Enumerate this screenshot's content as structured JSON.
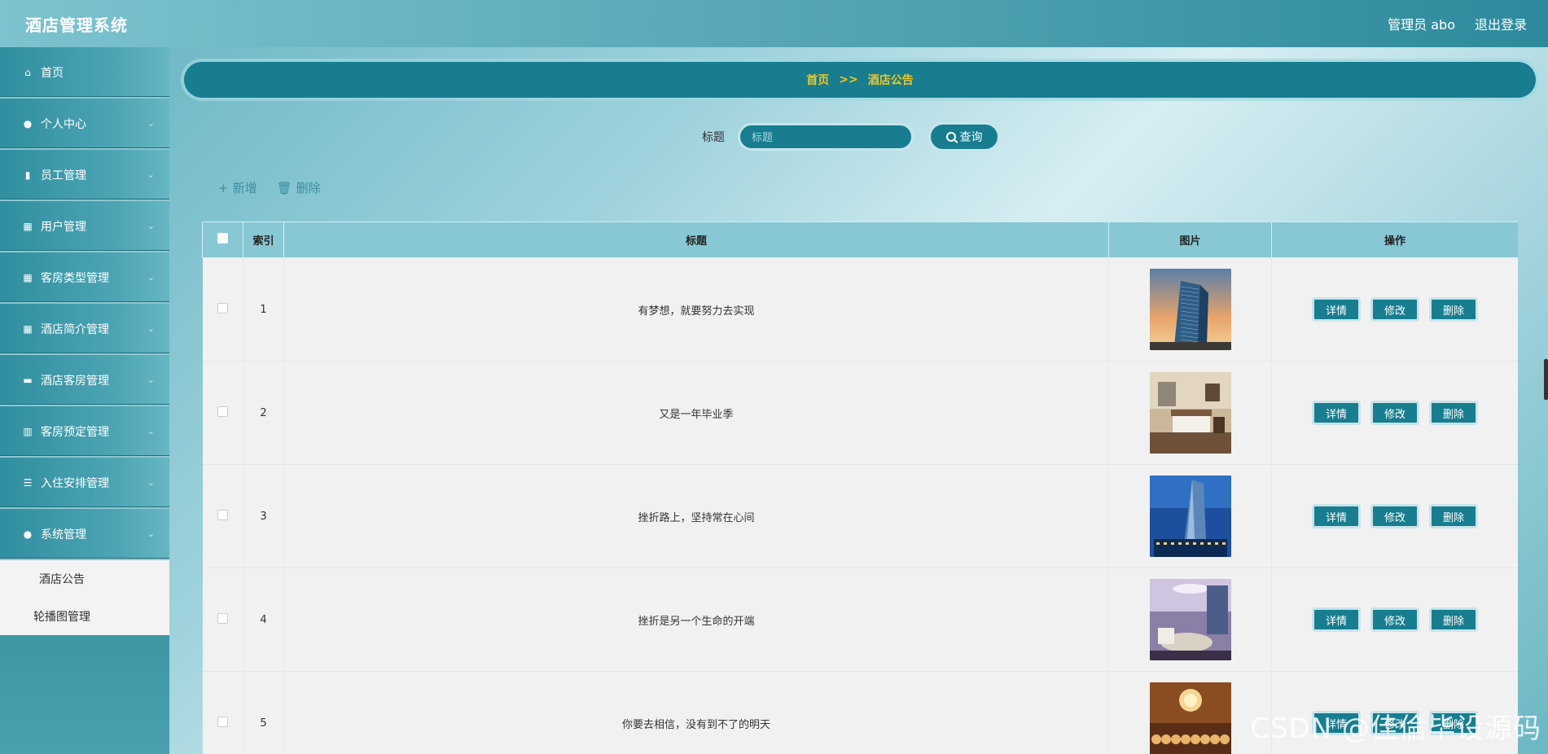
{
  "header": {
    "title": "酒店管理系统",
    "user": "管理员 abo",
    "logout": "退出登录"
  },
  "sidebar": {
    "items": [
      {
        "label": "首页",
        "icon": "home-icon",
        "glyph": "⌂",
        "arrow": false
      },
      {
        "label": "个人中心",
        "icon": "user-icon",
        "glyph": "●",
        "arrow": true
      },
      {
        "label": "员工管理",
        "icon": "building-icon",
        "glyph": "▮",
        "arrow": true
      },
      {
        "label": "用户管理",
        "icon": "grid-icon",
        "glyph": "▦",
        "arrow": true
      },
      {
        "label": "客房类型管理",
        "icon": "grid-icon",
        "glyph": "▦",
        "arrow": true
      },
      {
        "label": "酒店简介管理",
        "icon": "grid-icon",
        "glyph": "▦",
        "arrow": true
      },
      {
        "label": "酒店客房管理",
        "icon": "chat-icon",
        "glyph": "▬",
        "arrow": true
      },
      {
        "label": "客房预定管理",
        "icon": "bar-chart-icon",
        "glyph": "▥",
        "arrow": true
      },
      {
        "label": "入住安排管理",
        "icon": "sliders-icon",
        "glyph": "☰",
        "arrow": true
      },
      {
        "label": "系统管理",
        "icon": "user-icon",
        "glyph": "●",
        "arrow": true
      }
    ],
    "sub_items": [
      "酒店公告",
      "轮播图管理"
    ]
  },
  "breadcrumb": {
    "home": "首页",
    "separator": ">>",
    "current": "酒店公告"
  },
  "search": {
    "label": "标题",
    "placeholder": "标题",
    "button": "查询"
  },
  "actions": {
    "add": "新增",
    "delete": "删除"
  },
  "table": {
    "columns": [
      "",
      "索引",
      "标题",
      "图片",
      "操作"
    ],
    "rows": [
      {
        "index": "1",
        "title": "有梦想，就要努力去实现",
        "image": "hotel-tower-dusk"
      },
      {
        "index": "2",
        "title": "又是一年毕业季",
        "image": "hotel-room-interior"
      },
      {
        "index": "3",
        "title": "挫折路上，坚持常在心间",
        "image": "hotel-tower-night"
      },
      {
        "index": "4",
        "title": "挫折是另一个生命的开端",
        "image": "hotel-suite-lounge"
      },
      {
        "index": "5",
        "title": "你要去相信，没有到不了的明天",
        "image": "hotel-ballroom"
      }
    ],
    "row_actions": {
      "detail": "详情",
      "edit": "修改",
      "delete": "删除"
    }
  },
  "watermark": "CSDN @佳倫毕设源码",
  "colors": {
    "accent": "#177d8f",
    "breadcrumb_text": "#f3c623",
    "header_cell": "#87c8d4"
  }
}
